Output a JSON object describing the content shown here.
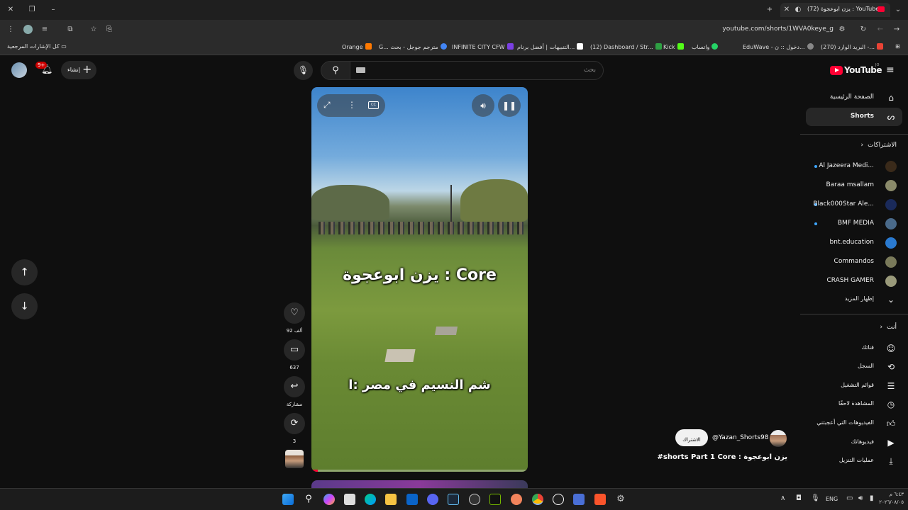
{
  "browser": {
    "tab_title": "(72) يزن ابوعجوة : YouTube",
    "new_tab": "+",
    "url": "youtube.com/shorts/1WVA0keye_g",
    "all_bookmarks": "كل الإشارات المرجعية",
    "bookmarks": [
      {
        "label": "Orange",
        "color": "#ff7900"
      },
      {
        "label": "G... مترجم جوجل - بحث",
        "color": "#4285f4"
      },
      {
        "label": "INFINITE CITY CFW",
        "color": "#7b3fe4"
      },
      {
        "label": "التنبيهات | أفضل برنام...",
        "color": "#ffffff"
      },
      {
        "label": "(12) Dashboard / Str...",
        "color": "#2ea043"
      },
      {
        "label": "Kick",
        "color": "#53fc18"
      },
      {
        "label": "واتساب",
        "color": "#25d366"
      },
      {
        "label": "EduWave - دخول :: ن...",
        "color": "#888888"
      },
      {
        "label": "(270) البريد الوارد -...",
        "color": "#ea4335"
      }
    ]
  },
  "header": {
    "logo_text": "YouTube",
    "logo_region": "JO",
    "search_placeholder": "بحث",
    "create_label": "إنشاء",
    "notif_count": "9+"
  },
  "sidebar": {
    "home": "الصفحة الرئيسية",
    "shorts": "Shorts",
    "subscriptions_title": "الاشتراكات",
    "subscriptions": [
      {
        "name": "Al Jazeera Medi...",
        "dot": true,
        "color": "#6b4f2a"
      },
      {
        "name": "Baraa msallam",
        "dot": false,
        "color": "#8a8a6a"
      },
      {
        "name": "Black000Star Ale...",
        "dot": true,
        "color": "#1a2a5a"
      },
      {
        "name": "BMF MEDIA",
        "dot": true,
        "color": "#4a6a8a"
      },
      {
        "name": "bnt.education",
        "dot": false,
        "color": "#2a7ad0"
      },
      {
        "name": "Commandos",
        "dot": false,
        "color": "#7a7a5a"
      },
      {
        "name": "CRASH GAMER",
        "dot": false,
        "color": "#9a9a7a"
      }
    ],
    "show_more": "إظهار المزيد",
    "you_title": "أنت",
    "you_items": [
      {
        "label": "قناتك",
        "icon": "channel-icon"
      },
      {
        "label": "السجل",
        "icon": "history-icon"
      },
      {
        "label": "قوائم التشغيل",
        "icon": "playlists-icon"
      },
      {
        "label": "المشاهدة لاحقًا",
        "icon": "clock-icon"
      },
      {
        "label": "الفيديوهات التي أعجبتني",
        "icon": "like-icon"
      },
      {
        "label": "فيديوهاتك",
        "icon": "video-icon"
      },
      {
        "label": "عمليات التنزيل",
        "icon": "download-icon"
      }
    ]
  },
  "short": {
    "caption_top": "يزن ابوعجوة : Core",
    "caption_bottom": "شم النسيم في مصر :ا",
    "likes": "92 ألف",
    "comments": "637",
    "share": "مشاركة",
    "remix": "3",
    "channel": "@Yazan_Shorts98",
    "subscribe": "الاشتراك",
    "title": "#shorts Part 1 Core : يزن ابوعجوة"
  },
  "taskbar": {
    "lang": "ENG",
    "time": "٦:٤٣ م",
    "date": "٢٠٢٦/٠٨/٠٥"
  }
}
